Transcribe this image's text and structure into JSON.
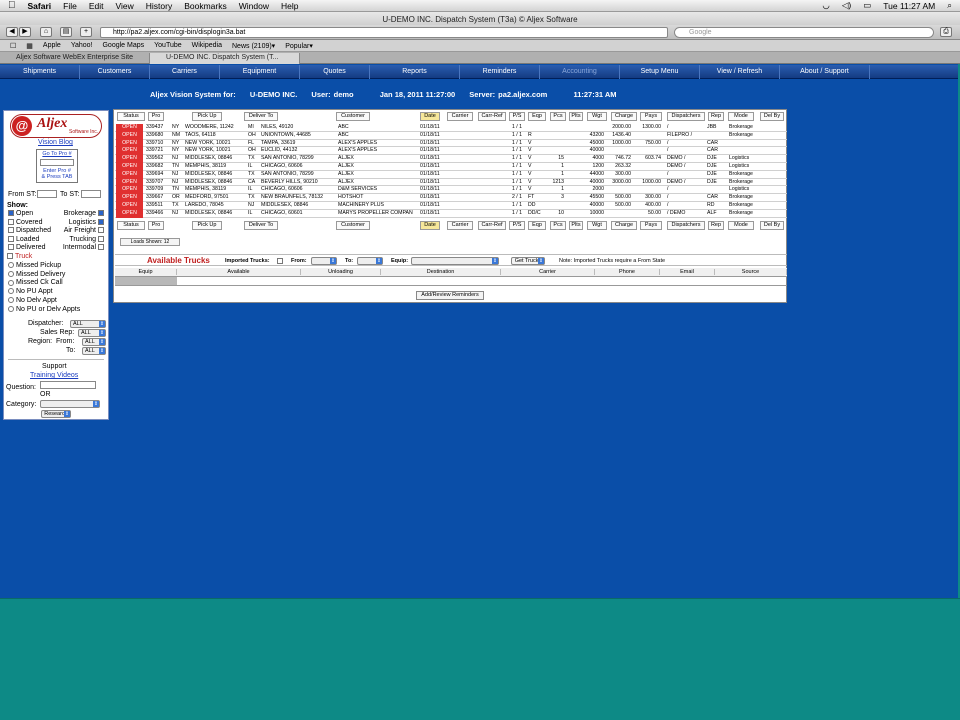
{
  "mac_menu": {
    "apple": "",
    "app": "Safari",
    "items": [
      "File",
      "Edit",
      "View",
      "History",
      "Bookmarks",
      "Window",
      "Help"
    ],
    "clock": "Tue 11:27 AM"
  },
  "window": {
    "title": "U-DEMO INC. Dispatch System (T3a) © Aljex Software",
    "url": "http://pa2.aljex.com/cgi-bin/displogin3a.bat",
    "search_placeholder": "Google"
  },
  "bookmarks": [
    "Apple",
    "Yahoo!",
    "Google Maps",
    "YouTube",
    "Wikipedia",
    "News (2109)▾",
    "Popular▾"
  ],
  "tabs": [
    {
      "label": "Aljex Software WebEx Enterprise Site",
      "active": false
    },
    {
      "label": "U-DEMO INC. Dispatch System (T...",
      "active": true
    }
  ],
  "nav": [
    {
      "label": "Shipments",
      "dim": false
    },
    {
      "label": "Customers",
      "dim": false
    },
    {
      "label": "Carriers",
      "dim": false
    },
    {
      "label": "Equipment",
      "dim": false
    },
    {
      "label": "Quotes",
      "dim": false
    },
    {
      "label": "Reports",
      "dim": false
    },
    {
      "label": "Reminders",
      "dim": false
    },
    {
      "label": "Accounting",
      "dim": true
    },
    {
      "label": "Setup Menu",
      "dim": false
    },
    {
      "label": "View / Refresh",
      "dim": false
    },
    {
      "label": "About / Support",
      "dim": false
    }
  ],
  "header": {
    "system": "Aljex Vision System for:",
    "company": "U-DEMO INC.",
    "user_label": "User:",
    "user": "demo",
    "datetime": "Jan 18, 2011 11:27:00",
    "server_label": "Server:",
    "server": "pa2.aljex.com",
    "server_time": "11:27:31 AM"
  },
  "sidebar": {
    "logo_at": "@",
    "logo_name": "Aljex",
    "logo_sub": "Software Inc.",
    "vision_blog": "Vision Blog",
    "go_to_pro": "Go To Pro #",
    "enter_pro": "Enter Pro #",
    "press_tab": "& Press TAB",
    "from_st": "From ST:",
    "to_st": "To ST:",
    "show": "Show:",
    "checks_left": [
      {
        "label": "Open",
        "on": true
      },
      {
        "label": "Covered",
        "on": false
      },
      {
        "label": "Dispatched",
        "on": false
      },
      {
        "label": "Loaded",
        "on": false
      },
      {
        "label": "Delivered",
        "on": false
      }
    ],
    "checks_right": [
      {
        "label": "Brokerage",
        "on": true
      },
      {
        "label": "Logistics",
        "on": true
      },
      {
        "label": "Air Freight",
        "on": false
      },
      {
        "label": "Trucking",
        "on": false
      },
      {
        "label": "Intermodal",
        "on": false
      }
    ],
    "truck": "Truck",
    "radios": [
      "Missed Pickup",
      "Missed Delivery",
      "Missed Ck Call",
      "No PU Appt",
      "No Delv Appt",
      "No PU or Delv Appts"
    ],
    "dispatcher_label": "Dispatcher:",
    "sales_rep_label": "Sales Rep:",
    "region_label": "Region:",
    "from_label": "From:",
    "to_label": "To:",
    "all": "ALL",
    "support": "Support",
    "training_videos": "Training Videos",
    "question": "Question:",
    "or": "OR",
    "category": "Category:",
    "research": "Research"
  },
  "table": {
    "headers": [
      "Status",
      "Pro",
      "Pick Up",
      "Deliver To",
      "Customer",
      "Date",
      "Carrier",
      "Carr-Ref",
      "P/S",
      "Eqp",
      "Pcs",
      "Plts",
      "Wgt",
      "Charge",
      "Pays",
      "Dispatchers",
      "Rep",
      "Mode",
      "Del By"
    ],
    "rows": [
      [
        "OPEN",
        "339437",
        "NY",
        "WOODMERE, 11242",
        "MI",
        "NILES, 49120",
        "ABC",
        "01/18/11",
        "1 / 1",
        "",
        "",
        "",
        "",
        "2000.00",
        "1300.00",
        "/",
        "JBB",
        "Brokerage"
      ],
      [
        "OPEN",
        "339680",
        "NM",
        "TAOS, 64118",
        "OH",
        "UNIONTOWN, 44685",
        "ABC",
        "01/18/11",
        "1 / 1",
        "R",
        "",
        "",
        "43200",
        "1436.40",
        "",
        "FILEPRO /",
        "",
        "Brokerage"
      ],
      [
        "OPEN",
        "339710",
        "NY",
        "NEW YORK, 10021",
        "FL",
        "TAMPA, 33619",
        "ALEX'S APPLES",
        "01/18/11",
        "1 / 1",
        "V",
        "",
        "",
        "45000",
        "1000.00",
        "750.00",
        "/",
        "CAR",
        ""
      ],
      [
        "OPEN",
        "339721",
        "NY",
        "NEW YORK, 10021",
        "OH",
        "EUCLID, 44132",
        "ALEX'S APPLES",
        "01/18/11",
        "1 / 1",
        "V",
        "",
        "",
        "40000",
        "",
        "",
        "/",
        "CAR",
        ""
      ],
      [
        "OPEN",
        "339562",
        "NJ",
        "MIDDLESEX, 08846",
        "TX",
        "SAN ANTONIO, 78299",
        "ALJEX",
        "01/18/11",
        "1 / 1",
        "V",
        "15",
        "",
        "4000",
        "746.72",
        "603.74",
        "DEMO /",
        "DJE",
        "Logistics"
      ],
      [
        "OPEN",
        "339682",
        "TN",
        "MEMPHIS, 38119",
        "IL",
        "CHICAGO, 60606",
        "ALJEX",
        "01/18/11",
        "1 / 1",
        "V",
        "1",
        "",
        "1200",
        "263.32",
        "",
        "DEMO /",
        "DJE",
        "Logistics"
      ],
      [
        "OPEN",
        "339694",
        "NJ",
        "MIDDLESEX, 08846",
        "TX",
        "SAN ANTONIO, 78299",
        "ALJEX",
        "01/18/11",
        "1 / 1",
        "V",
        "1",
        "",
        "44000",
        "300.00",
        "",
        "/",
        "DJE",
        "Brokerage"
      ],
      [
        "OPEN",
        "339707",
        "NJ",
        "MIDDLESEX, 08846",
        "CA",
        "BEVERLY HILLS, 90210",
        "ALJEX",
        "01/18/11",
        "1 / 1",
        "V",
        "1213",
        "",
        "40000",
        "3000.00",
        "1000.00",
        "DEMO /",
        "DJE",
        "Brokerage"
      ],
      [
        "OPEN",
        "339709",
        "TN",
        "MEMPHIS, 38119",
        "IL",
        "CHICAGO, 60606",
        "D&M SERVICES",
        "01/18/11",
        "1 / 1",
        "V",
        "1",
        "",
        "2000",
        "",
        "",
        "/",
        "",
        "Logistics"
      ],
      [
        "OPEN",
        "339667",
        "OR",
        "MEDFORD, 97501",
        "TX",
        "NEW BRAUNFELS, 78132",
        "HOTSHOT",
        "01/18/11",
        "2 / 1",
        "FT",
        "3",
        "",
        "45500",
        "500.00",
        "300.00",
        "/",
        "CAR",
        "Brokerage"
      ],
      [
        "OPEN",
        "339511",
        "TX",
        "LAREDO, 78045",
        "NJ",
        "MIDDLESEX, 08846",
        "MACHINERY PLUS",
        "01/18/11",
        "1 / 1",
        "DD",
        "",
        "",
        "40000",
        "500.00",
        "400.00",
        "/",
        "RD",
        "Brokerage"
      ],
      [
        "OPEN",
        "339466",
        "NJ",
        "MIDDLESEX, 08846",
        "IL",
        "CHICAGO, 60601",
        "MARYS PROPELLER COMPAN",
        "01/18/11",
        "1 / 1",
        "DD/C",
        "10",
        "",
        "10000",
        "",
        "50.00",
        "/ DEMO",
        "ALF",
        "Brokerage"
      ]
    ],
    "loads_shown": "Loads Shown: 12"
  },
  "trucks": {
    "title": "Available Trucks",
    "imported": "Imported Trucks:",
    "from": "From:",
    "to": "To:",
    "equip": "Equip:",
    "get_trucks": "Get Trucks",
    "note": "Note:  Imported Trucks require a From State",
    "columns": [
      "Equip",
      "Available",
      "Unloading",
      "Destination",
      "Carrier",
      "Phone",
      "Email",
      "Source"
    ],
    "add_review": "Add/Review Reminders"
  },
  "colors": {
    "page_blue": "#0a4ea8",
    "status_red": "#e03030",
    "bottom_teal": "#0d8a86"
  }
}
